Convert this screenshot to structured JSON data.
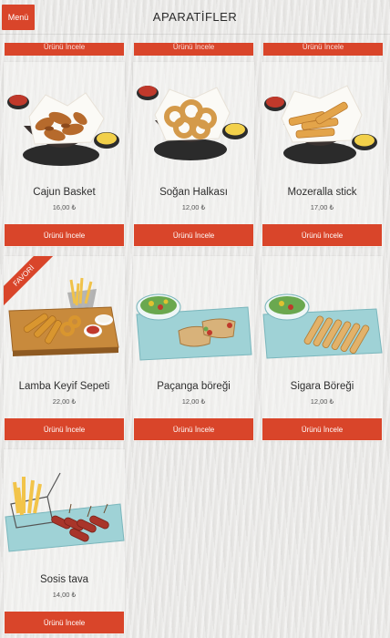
{
  "header": {
    "menu_label": "Menü",
    "title": "APARATİFLER"
  },
  "top_row_buttons": [
    "Ürünü İncele",
    "Ürünü İncele",
    "Ürünü İncele"
  ],
  "products": [
    {
      "name": "Cajun Basket",
      "price": "16,00 ₺",
      "button": "Ürünü İncele",
      "image": "fried-chicken-basket"
    },
    {
      "name": "Soğan Halkası",
      "price": "12,00 ₺",
      "button": "Ürünü İncele",
      "image": "onion-rings-basket"
    },
    {
      "name": "Mozeralla stick",
      "price": "17,00 ₺",
      "button": "Ürünü İncele",
      "image": "mozzarella-sticks-basket"
    },
    {
      "name": "Lamba Keyif Sepeti",
      "price": "22,00 ₺",
      "button": "Ürünü İncele",
      "image": "snack-platter-board",
      "badge": "FAVORİ"
    },
    {
      "name": "Paçanga böreği",
      "price": "12,00 ₺",
      "button": "Ürünü İncele",
      "image": "wrap-plate-salad"
    },
    {
      "name": "Sigara Böreği",
      "price": "12,00 ₺",
      "button": "Ürünü İncele",
      "image": "cigar-pastry-plate"
    },
    {
      "name": "Sosis tava",
      "price": "14,00 ₺",
      "button": "Ürünü İncele",
      "image": "sausage-fries-plate"
    }
  ],
  "colors": {
    "accent": "#d9452a",
    "background": "#e9e8e6"
  }
}
